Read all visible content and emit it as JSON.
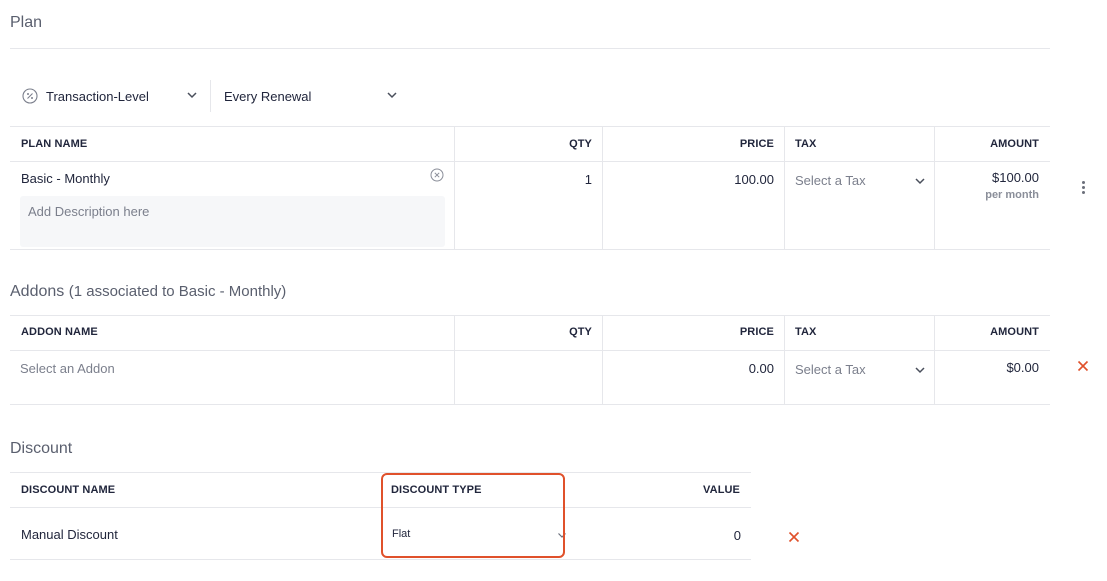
{
  "plan": {
    "title": "Plan",
    "discount_level": "Transaction-Level",
    "renewal": "Every Renewal",
    "headers": {
      "name": "PLAN NAME",
      "qty": "QTY",
      "price": "PRICE",
      "tax": "TAX",
      "amount": "AMOUNT"
    },
    "row": {
      "name": "Basic - Monthly",
      "description_placeholder": "Add Description here",
      "qty": "1",
      "price": "100.00",
      "tax_placeholder": "Select a Tax",
      "amount": "$100.00",
      "amount_period": "per month"
    }
  },
  "addons": {
    "title": "Addons",
    "subtitle": "(1 associated to Basic - Monthly)",
    "headers": {
      "name": "ADDON NAME",
      "qty": "QTY",
      "price": "PRICE",
      "tax": "TAX",
      "amount": "AMOUNT"
    },
    "row": {
      "name_placeholder": "Select an Addon",
      "qty": "",
      "price": "0.00",
      "tax_placeholder": "Select a Tax",
      "amount": "$0.00"
    }
  },
  "discount": {
    "title": "Discount",
    "headers": {
      "name": "DISCOUNT NAME",
      "type": "DISCOUNT TYPE",
      "value": "VALUE"
    },
    "row": {
      "name": "Manual Discount",
      "type": "Flat",
      "value": "0"
    }
  },
  "colors": {
    "remove": "#e0512b",
    "highlight": "#e0512b"
  }
}
